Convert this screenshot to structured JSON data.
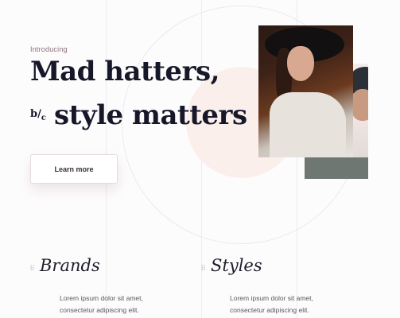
{
  "hero": {
    "intro": "Introducing",
    "headline_line1": "Mad hatters,",
    "bc_top": "b",
    "bc_bottom": "c",
    "headline_line2": "style matters",
    "cta_label": "Learn more"
  },
  "images": {
    "main_photo": "woman-in-hat-photo",
    "side_photo": "man-in-cap-photo"
  },
  "features": [
    {
      "title": "Brands",
      "text_line1": "Lorem ipsum dolor sit amet,",
      "text_line2": "consectetur adipiscing elit."
    },
    {
      "title": "Styles",
      "text_line1": "Lorem ipsum dolor sit amet,",
      "text_line2": "consectetur adipiscing elit."
    }
  ],
  "colors": {
    "background": "#fdfcfc",
    "headline": "#17172a",
    "accent_pink": "#fbefec",
    "intro_text": "#8a6f7a"
  }
}
